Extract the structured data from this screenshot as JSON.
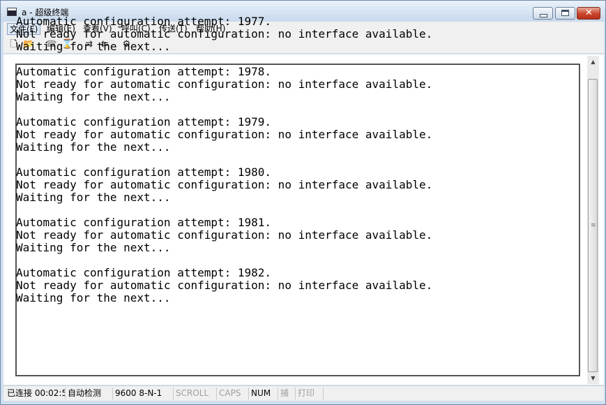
{
  "window": {
    "title": "a - 超级终端",
    "close_glyph": "✕"
  },
  "menu": [
    {
      "label": "文件(F)"
    },
    {
      "label": "编辑(E)"
    },
    {
      "label": "查看(V)"
    },
    {
      "label": "呼叫(C)"
    },
    {
      "label": "传送(T)"
    },
    {
      "label": "帮助(H)"
    }
  ],
  "toolbar": [
    {
      "icon": "new-file-icon",
      "glyph": "🗋"
    },
    {
      "icon": "open-folder-icon",
      "glyph": "📂"
    },
    {
      "icon": "call-icon",
      "glyph": "☎"
    },
    {
      "icon": "hangup-icon",
      "glyph": "⌛"
    },
    {
      "icon": "send-icon",
      "glyph": "⇉"
    },
    {
      "icon": "receive-icon",
      "glyph": "⇇"
    },
    {
      "icon": "properties-icon",
      "glyph": "⚙"
    }
  ],
  "terminal": {
    "text": "Automatic configuration attempt: 1977.\nNot ready for automatic configuration: no interface available.\nWaiting for the next...\n\nAutomatic configuration attempt: 1978.\nNot ready for automatic configuration: no interface available.\nWaiting for the next...\n\nAutomatic configuration attempt: 1979.\nNot ready for automatic configuration: no interface available.\nWaiting for the next...\n\nAutomatic configuration attempt: 1980.\nNot ready for automatic configuration: no interface available.\nWaiting for the next...\n\nAutomatic configuration attempt: 1981.\nNot ready for automatic configuration: no interface available.\nWaiting for the next...\n\nAutomatic configuration attempt: 1982.\nNot ready for automatic configuration: no interface available.\nWaiting for the next..."
  },
  "scrollbar": {
    "up": "▲",
    "down": "▼",
    "grip": "≡"
  },
  "status": {
    "connection": "已连接 00:02:5",
    "detect": "自动检测",
    "port": "9600 8-N-1",
    "scroll": "SCROLL",
    "caps": "CAPS",
    "num": "NUM",
    "capture": "捕",
    "print": "打印"
  }
}
